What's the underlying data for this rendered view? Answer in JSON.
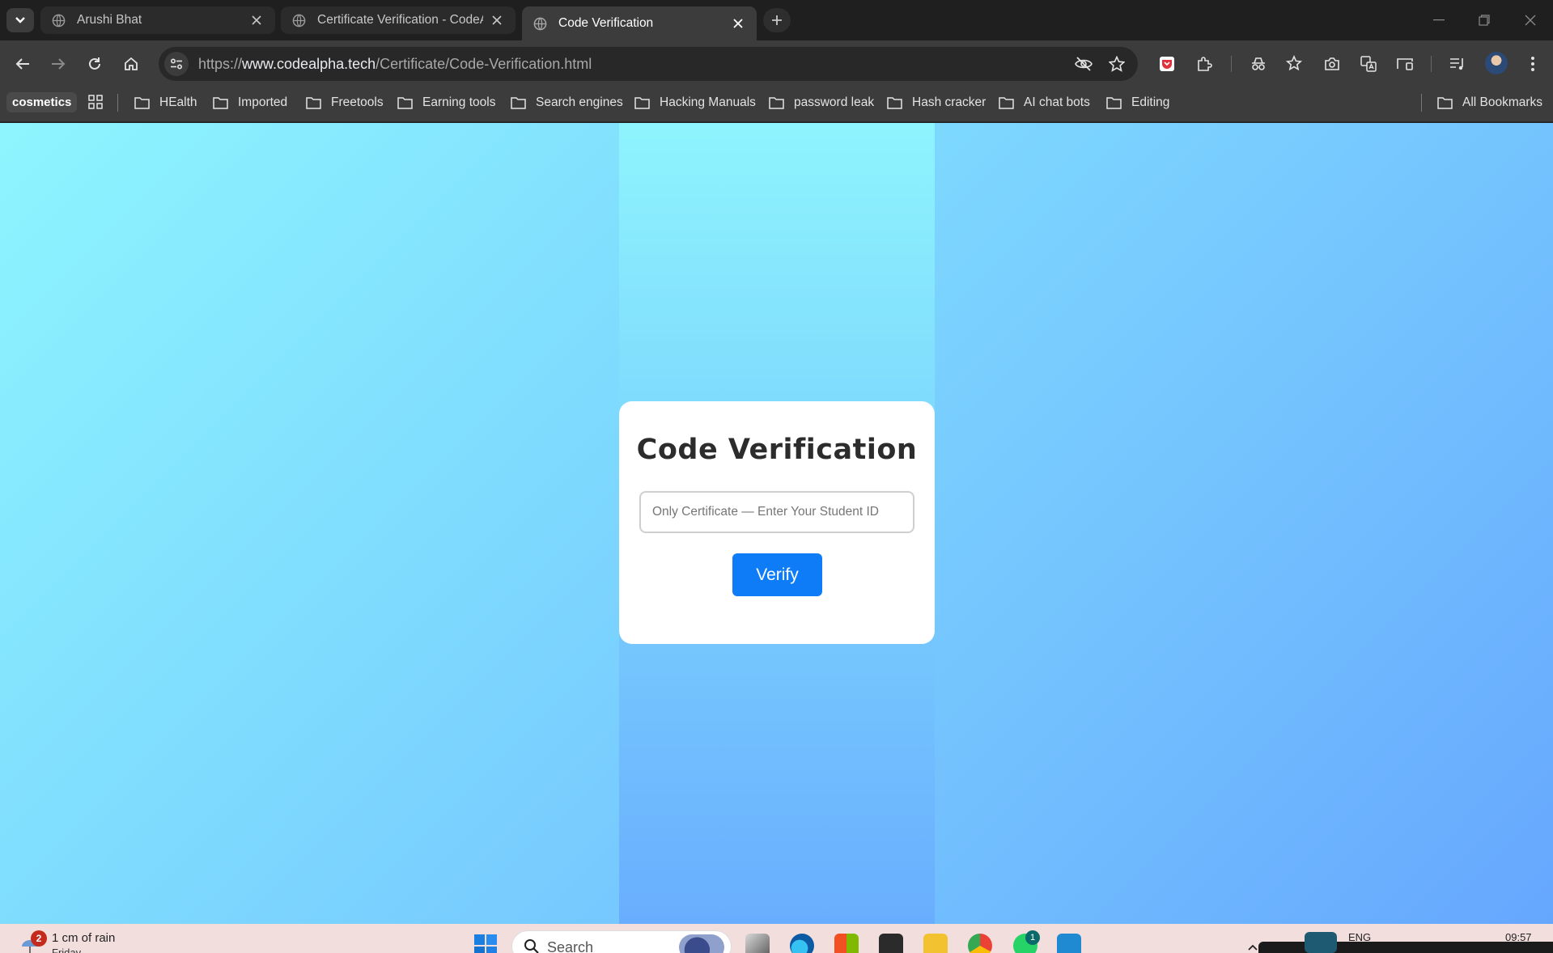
{
  "browser": {
    "tabs": [
      {
        "title": "Arushi Bhat",
        "active": false
      },
      {
        "title": "Certificate Verification - CodeAl",
        "active": false
      },
      {
        "title": "Code Verification",
        "active": true
      }
    ],
    "url_scheme": "https://",
    "url_host": "www.codealpha.tech",
    "url_path": "/Certificate/Code-Verification.html"
  },
  "bookmarks": {
    "chip": "cosmetics",
    "folders": [
      "HEalth",
      "Imported",
      "Freetools",
      "Earning tools",
      "Search engines",
      "Hacking Manuals",
      "password leak",
      "Hash cracker",
      "AI chat bots",
      "Editing"
    ],
    "all_bookmarks": "All Bookmarks"
  },
  "page": {
    "title": "Code Verification",
    "input_placeholder": "Only Certificate — Enter Your Student ID",
    "verify_label": "Verify",
    "colors": {
      "button": "#0f7cf7",
      "gradient_start": "#8ef5fe",
      "gradient_end": "#66a7fe"
    }
  },
  "taskbar": {
    "weather_badge": "2",
    "weather_text": "1 cm of rain",
    "weather_sub": "Friday",
    "search_label": "Search",
    "whatsapp_badge": "1",
    "language": "ENG",
    "time": "09:57"
  }
}
